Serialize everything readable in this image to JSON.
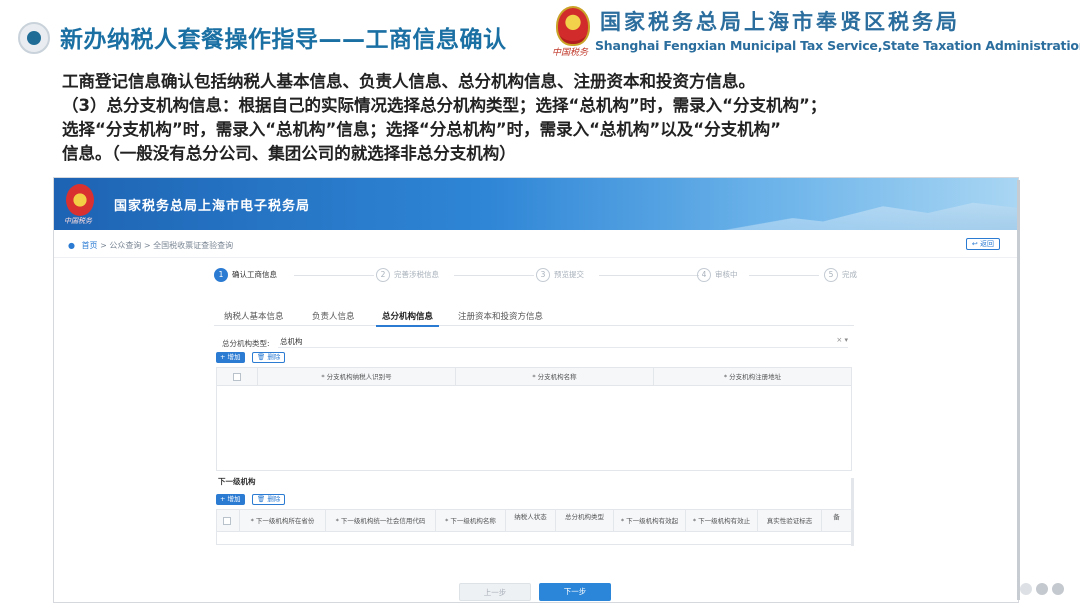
{
  "slide": {
    "title": "新办纳税人套餐操作指导——工商信息确认",
    "bureau_cn": "国家税务总局上海市奉贤区税务局",
    "bureau_en": "Shanghai Fengxian Municipal Tax Service,State Taxation Administration",
    "emblem_signature": "中国税务",
    "intro_lines": [
      "工商登记信息确认包括纳税人基本信息、负责人信息、总分机构信息、注册资本和投资方信息。",
      "（3）总分支机构信息：根据自己的实际情况选择总分机构类型；选择“总机构”时，需录入“分支机构”；",
      "选择“分支机构”时，需录入“总机构”信息；选择“分总机构”时，需录入“总机构”以及“分支机构”",
      "信息。（一般没有总分公司、集团公司的就选择非总分支机构）"
    ]
  },
  "site": {
    "title": "国家税务总局上海市电子税务局",
    "logo_signature": "中国税务",
    "breadcrumb": {
      "home": "首页",
      "sep": ">",
      "item1": "公众查询",
      "item2": "全国税收票证查验查询"
    },
    "back_label": "返回"
  },
  "steps": [
    {
      "num": "1",
      "label": "确认工商信息"
    },
    {
      "num": "2",
      "label": "完善涉税信息"
    },
    {
      "num": "3",
      "label": "预览提交"
    },
    {
      "num": "4",
      "label": "审核中"
    },
    {
      "num": "5",
      "label": "完成"
    }
  ],
  "tabs": [
    "纳税人基本信息",
    "负责人信息",
    "总分机构信息",
    "注册资本和投资方信息"
  ],
  "form": {
    "type_label": "总分机构类型:",
    "type_value": "总机构",
    "type_controls": "× ▾"
  },
  "branch_section": {
    "add_label": "+ 增加",
    "delete_label": "🗑 删除",
    "columns": [
      "* 分支机构纳税人识别号",
      "* 分支机构名称",
      "* 分支机构注册地址"
    ]
  },
  "sub_section": {
    "title": "下一级机构",
    "add_label": "+ 增加",
    "delete_label": "🗑 删除",
    "columns": [
      "* 下一级机构所在省份",
      "* 下一级机构统一社会信用代码",
      "* 下一级机构名称",
      "纳税人状态",
      "总分机构类型",
      "* 下一级机构有效起",
      "* 下一级机构有效止",
      "真实性验证标志",
      "备"
    ]
  },
  "footer": {
    "prev_label": "上一步",
    "next_label": "下一步"
  },
  "colors": {
    "accent": "#2b7bd3",
    "title": "#1a6fa3"
  }
}
